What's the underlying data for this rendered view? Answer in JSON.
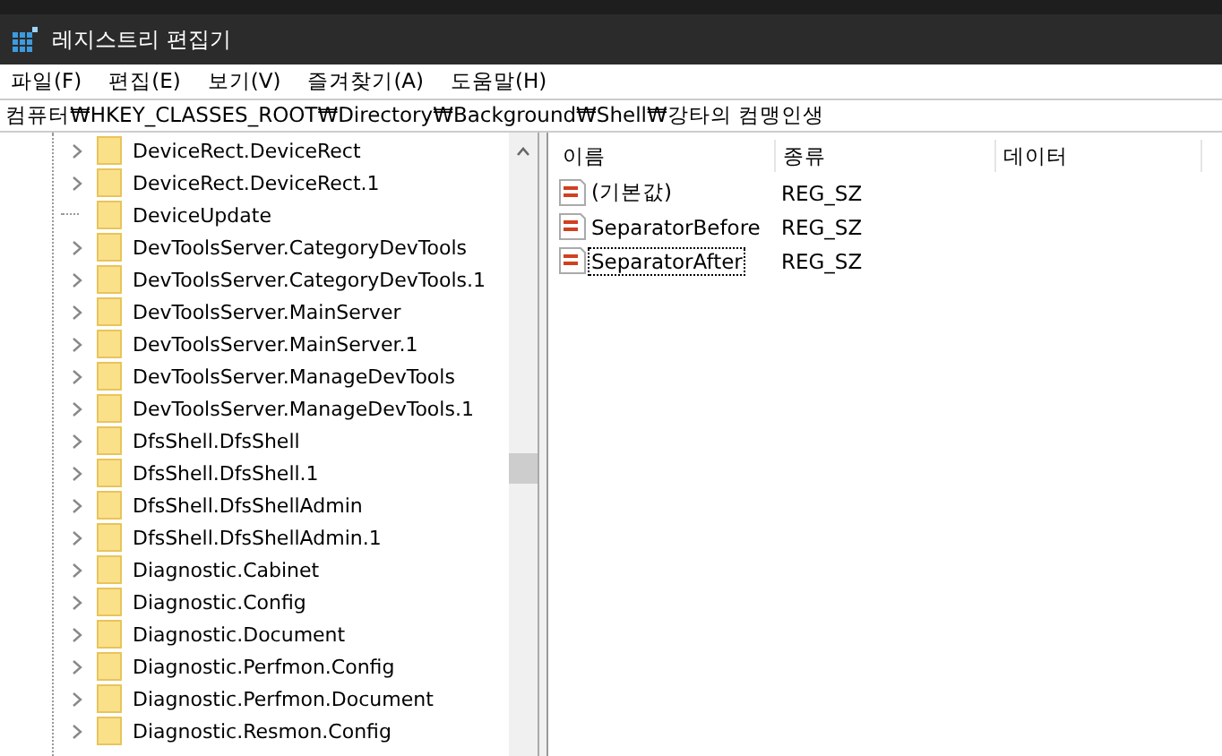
{
  "window": {
    "title": "레지스트리 편집기"
  },
  "menu": [
    "파일(F)",
    "편집(E)",
    "보기(V)",
    "즐겨찾기(A)",
    "도움말(H)"
  ],
  "address": "컴퓨터₩HKEY_CLASSES_ROOT₩Directory₩Background₩Shell₩강타의 컴맹인생",
  "tree": [
    {
      "label": "DeviceRect.DeviceRect",
      "expandable": true
    },
    {
      "label": "DeviceRect.DeviceRect.1",
      "expandable": true
    },
    {
      "label": "DeviceUpdate",
      "expandable": false
    },
    {
      "label": "DevToolsServer.CategoryDevTools",
      "expandable": true
    },
    {
      "label": "DevToolsServer.CategoryDevTools.1",
      "expandable": true
    },
    {
      "label": "DevToolsServer.MainServer",
      "expandable": true
    },
    {
      "label": "DevToolsServer.MainServer.1",
      "expandable": true
    },
    {
      "label": "DevToolsServer.ManageDevTools",
      "expandable": true
    },
    {
      "label": "DevToolsServer.ManageDevTools.1",
      "expandable": true
    },
    {
      "label": "DfsShell.DfsShell",
      "expandable": true
    },
    {
      "label": "DfsShell.DfsShell.1",
      "expandable": true
    },
    {
      "label": "DfsShell.DfsShellAdmin",
      "expandable": true
    },
    {
      "label": "DfsShell.DfsShellAdmin.1",
      "expandable": true
    },
    {
      "label": "Diagnostic.Cabinet",
      "expandable": true
    },
    {
      "label": "Diagnostic.Config",
      "expandable": true
    },
    {
      "label": "Diagnostic.Document",
      "expandable": true
    },
    {
      "label": "Diagnostic.Perfmon.Config",
      "expandable": true
    },
    {
      "label": "Diagnostic.Perfmon.Document",
      "expandable": true
    },
    {
      "label": "Diagnostic.Resmon.Config",
      "expandable": true
    }
  ],
  "values": {
    "columns": [
      "이름",
      "종류",
      "데이터"
    ],
    "rows": [
      {
        "name": "(기본값)",
        "type": "REG_SZ",
        "selected": false
      },
      {
        "name": "SeparatorBefore",
        "type": "REG_SZ",
        "selected": false
      },
      {
        "name": "SeparatorAfter",
        "type": "REG_SZ",
        "selected": true
      }
    ]
  }
}
